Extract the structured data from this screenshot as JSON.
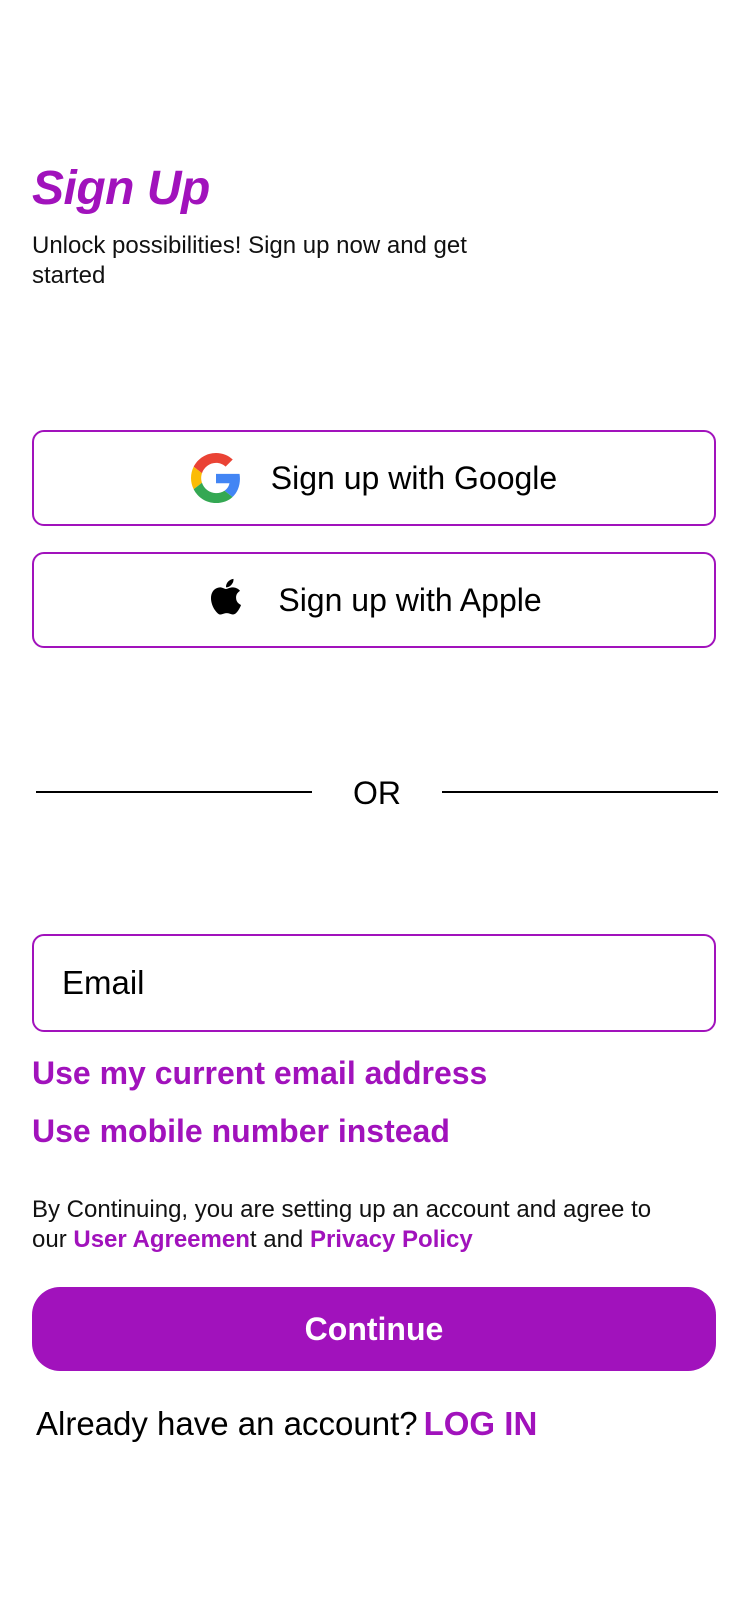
{
  "header": {
    "title": "Sign Up",
    "subtitle": "Unlock possibilities! Sign up now and get started"
  },
  "social": {
    "google_label": "Sign up with Google",
    "apple_label": "Sign up with Apple"
  },
  "divider": {
    "text": "OR"
  },
  "email": {
    "placeholder": "Email",
    "value": ""
  },
  "links": {
    "current_email": "Use my current email address",
    "mobile_instead": "Use mobile number instead"
  },
  "terms": {
    "prefix": "By Continuing, you are setting up an account and agree to our ",
    "user_agreement": "User Agreemen",
    "user_agreement_tail": "t",
    "conjunction": " and ",
    "privacy_policy": "Privacy Policy"
  },
  "actions": {
    "continue_label": "Continue"
  },
  "footer": {
    "prompt": "Already have an account?",
    "login_label": "LOG IN"
  },
  "colors": {
    "accent": "#a112bc",
    "background": "#ffffff",
    "text": "#000000"
  },
  "icons": {
    "google": "google-logo-icon",
    "apple": "apple-logo-icon"
  }
}
